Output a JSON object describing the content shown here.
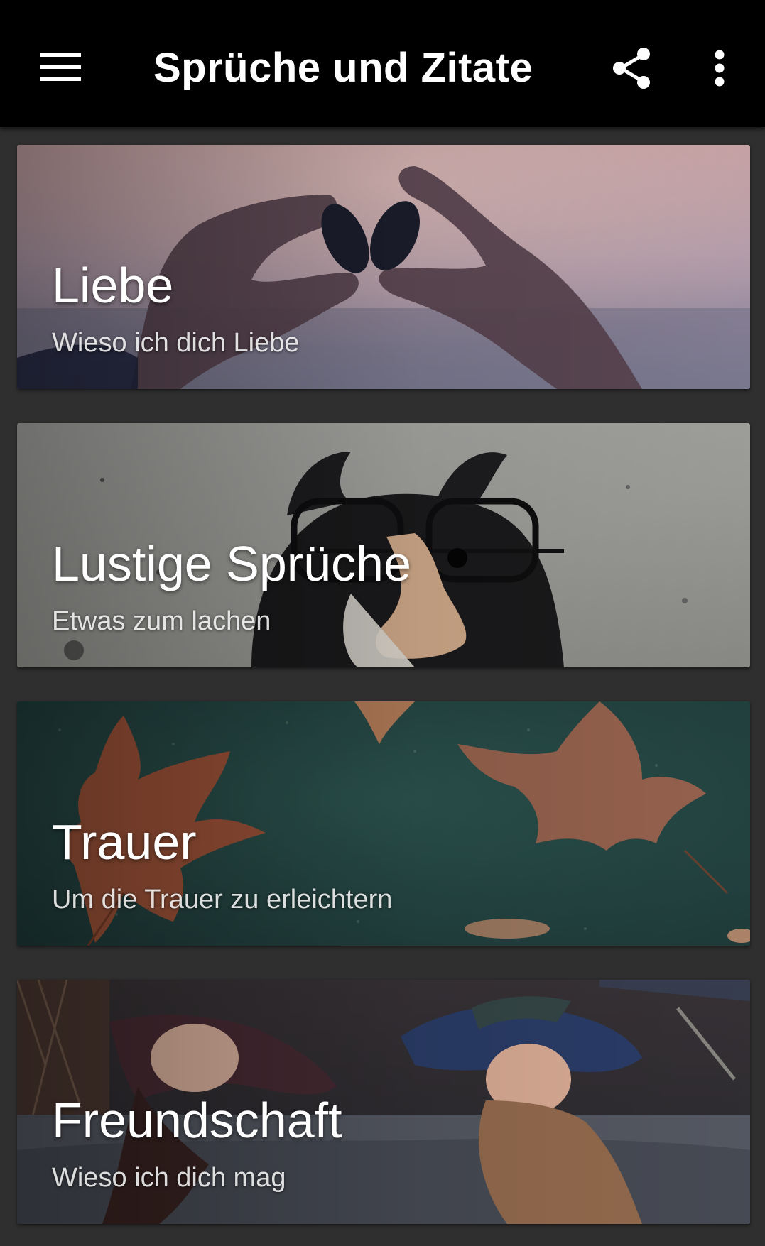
{
  "appbar": {
    "title": "Sprüche und Zitate",
    "menu_icon": "hamburger-menu-icon",
    "share_icon": "share-icon",
    "more_icon": "more-vert-icon"
  },
  "categories": [
    {
      "title": "Liebe",
      "subtitle": "Wieso ich dich Liebe",
      "image": "hands-heart-shells"
    },
    {
      "title": "Lustige Sprüche",
      "subtitle": "Etwas zum lachen",
      "image": "dog-with-funny-glasses"
    },
    {
      "title": "Trauer",
      "subtitle": "Um die Trauer zu erleichtern",
      "image": "autumn-leaves-on-ground"
    },
    {
      "title": "Freundschaft",
      "subtitle": "Wieso ich dich mag",
      "image": "friends-lying-on-car"
    }
  ],
  "colors": {
    "appbar": "#000000",
    "background": "#2f2f2f",
    "text": "#ffffff"
  }
}
